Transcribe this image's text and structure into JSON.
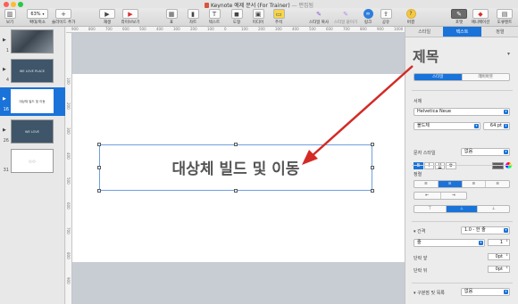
{
  "window": {
    "title": "Keynote 예제 문서 (For Trainer)",
    "edited_label": "— 편집됨"
  },
  "toolbar": {
    "zoom_value": "63%",
    "items": [
      {
        "label": "보기",
        "icon": "view-icon"
      },
      {
        "label": "확대/축소",
        "icon": "zoom-menu"
      },
      {
        "label": "슬라이드 추가",
        "icon": "add-slide-icon"
      },
      {
        "label": "재생",
        "icon": "play-icon"
      },
      {
        "label": "라이브보기",
        "icon": "live-icon"
      },
      {
        "label": "표",
        "icon": "table-icon"
      },
      {
        "label": "차트",
        "icon": "chart-icon"
      },
      {
        "label": "텍스트",
        "icon": "text-icon"
      },
      {
        "label": "도형",
        "icon": "shape-icon"
      },
      {
        "label": "미디어",
        "icon": "media-icon"
      },
      {
        "label": "주석",
        "icon": "comment-icon"
      },
      {
        "label": "스타일 복사",
        "icon": "copy-style-icon"
      },
      {
        "label": "스타일 붙이기",
        "icon": "paste-style-icon"
      },
      {
        "label": "링크",
        "icon": "link-icon"
      },
      {
        "label": "공유",
        "icon": "share-icon"
      },
      {
        "label": "버결",
        "icon": "tips-icon"
      },
      {
        "label": "포맷",
        "icon": "format-icon"
      },
      {
        "label": "애니메이션",
        "icon": "animate-icon"
      },
      {
        "label": "도큐멘트",
        "icon": "document-icon"
      }
    ]
  },
  "navigator": {
    "slides": [
      {
        "number": "1",
        "text": ""
      },
      {
        "number": "4",
        "text": "WE LOVE PLACE"
      },
      {
        "number": "16",
        "text": "대상체 빌드 및 이동"
      },
      {
        "number": "26",
        "text": "WE LOVE"
      },
      {
        "number": "31",
        "text": "○ ○"
      }
    ]
  },
  "slide": {
    "title": "대상체 빌드 및 이동"
  },
  "rulers": {
    "h_ticks": [
      "900",
      "800",
      "700",
      "600",
      "500",
      "400",
      "300",
      "200",
      "100",
      "0",
      "100",
      "200",
      "300",
      "400",
      "500",
      "600",
      "700",
      "800",
      "900",
      "1000"
    ],
    "v_ticks": [
      "100",
      "200",
      "300",
      "400",
      "500",
      "600",
      "700",
      "800",
      "900"
    ]
  },
  "inspector": {
    "tabs": [
      {
        "label": "스타일",
        "active": false
      },
      {
        "label": "텍스트",
        "active": true
      },
      {
        "label": "정렬",
        "active": false
      }
    ],
    "paragraph_style": "제목",
    "subtabs": [
      {
        "label": "스타일",
        "active": true
      },
      {
        "label": "레이아웃",
        "active": false
      }
    ],
    "font_section_label": "서체",
    "font_family": "Helvetica Neue",
    "font_weight": "볼드체",
    "font_size": "64 pt",
    "font_buttons": [
      "B",
      "I",
      "U"
    ],
    "char_style_label": "문자 스타일",
    "char_style_value": "없음",
    "align_section_label": "정렬",
    "spacing_label": "간격",
    "spacing_value": "1.0 - 한 줄",
    "line_unit": "줄",
    "line_value": "1",
    "para_before_label": "단락 앞",
    "para_before_value": "0pt",
    "para_after_label": "단락 뒤",
    "para_after_value": "0pt",
    "bullets_label": "구분점 및 목록",
    "bullets_value": "없음",
    "colors": {
      "accent": "#1a73d9",
      "text": "#5a5a5a"
    }
  }
}
